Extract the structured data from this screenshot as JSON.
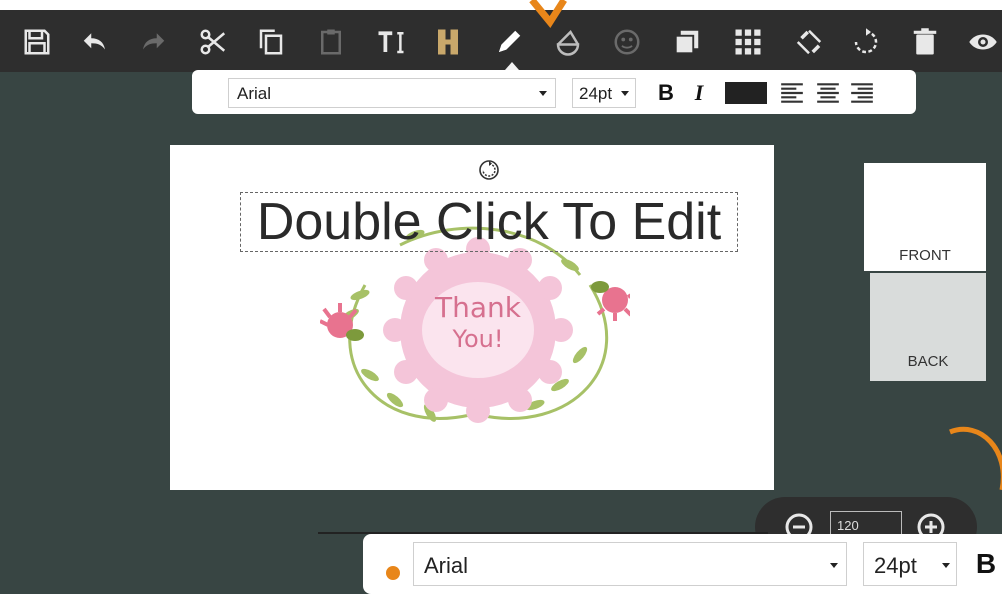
{
  "toolbar": {
    "items": [
      {
        "name": "save-icon",
        "label": "Save"
      },
      {
        "name": "undo-icon",
        "label": "Undo"
      },
      {
        "name": "redo-icon",
        "label": "Redo"
      },
      {
        "name": "cut-icon",
        "label": "Cut"
      },
      {
        "name": "copy-icon",
        "label": "Copy"
      },
      {
        "name": "paste-icon",
        "label": "Paste"
      },
      {
        "name": "text-icon",
        "label": "Text"
      },
      {
        "name": "image-icon",
        "label": "Image"
      },
      {
        "name": "pencil-icon",
        "label": "Draw"
      },
      {
        "name": "shape-icon",
        "label": "Shape"
      },
      {
        "name": "face-icon",
        "label": "Clipart"
      },
      {
        "name": "layer-icon",
        "label": "Layer"
      },
      {
        "name": "grid-icon",
        "label": "Grid"
      },
      {
        "name": "tool-icon",
        "label": "Tools"
      },
      {
        "name": "rotate-icon",
        "label": "Rotate"
      },
      {
        "name": "trash-icon",
        "label": "Delete"
      },
      {
        "name": "eye-icon",
        "label": "Preview"
      }
    ]
  },
  "format_bar": {
    "font": "Arial",
    "size": "24pt",
    "bold_label": "B",
    "italic_label": "I",
    "text_color": "#222222"
  },
  "canvas": {
    "text": "Double Click To Edit",
    "wreath_text_line1": "Thank",
    "wreath_text_line2": "You!"
  },
  "side_tabs": {
    "front": "FRONT",
    "back": "BACK"
  },
  "zoom": {
    "value": "120"
  },
  "overlay_bar": {
    "font": "Arial",
    "size": "24pt",
    "bold_label": "B"
  },
  "colors": {
    "toolbar_bg": "#2e2e2e",
    "workspace_bg": "#384543",
    "accent": "#e8861a"
  }
}
